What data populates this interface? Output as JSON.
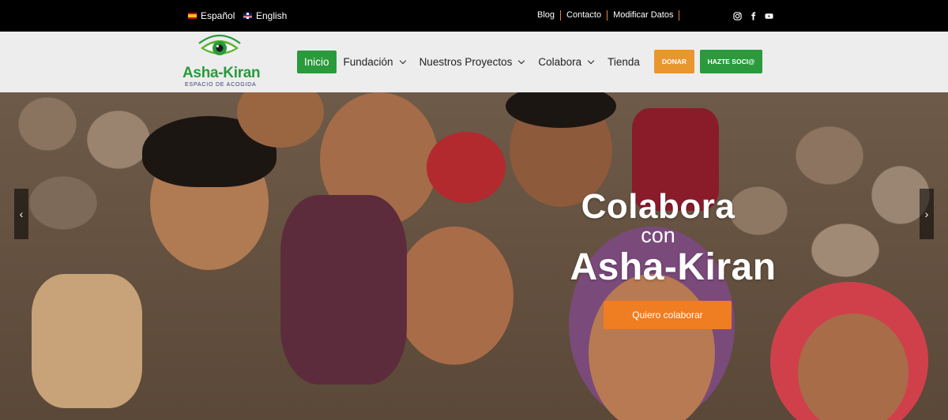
{
  "topbar": {
    "languages": [
      {
        "label": "Español",
        "flag": "flag-spain-icon"
      },
      {
        "label": "English",
        "flag": "flag-uk-icon"
      }
    ],
    "links": [
      "Blog",
      "Contacto",
      "Modificar Datos"
    ],
    "social_icons": [
      "instagram-icon",
      "facebook-icon",
      "youtube-icon"
    ]
  },
  "header": {
    "logo": {
      "name": "Asha-Kiran",
      "tagline": "ESPACIO DE ACOGIDA"
    },
    "nav": [
      {
        "label": "Inicio",
        "active": true,
        "dropdown": false
      },
      {
        "label": "Fundación",
        "active": false,
        "dropdown": true
      },
      {
        "label": "Nuestros Proyectos",
        "active": false,
        "dropdown": true
      },
      {
        "label": "Colabora",
        "active": false,
        "dropdown": true
      },
      {
        "label": "Tienda",
        "active": false,
        "dropdown": false
      }
    ],
    "buttons": {
      "donar": "DONAR",
      "socio": "HAZTE SOCI@"
    }
  },
  "hero": {
    "line1": "Colabora",
    "line2": "con",
    "line3": "Asha-Kiran",
    "cta": "Quiero colaborar",
    "prev_arrow": "‹",
    "next_arrow": "›"
  },
  "colors": {
    "brand_green": "#2a9a3c",
    "donate_orange": "#e8962d",
    "cta_orange": "#ef7d22",
    "topbar_bg": "#000000"
  }
}
